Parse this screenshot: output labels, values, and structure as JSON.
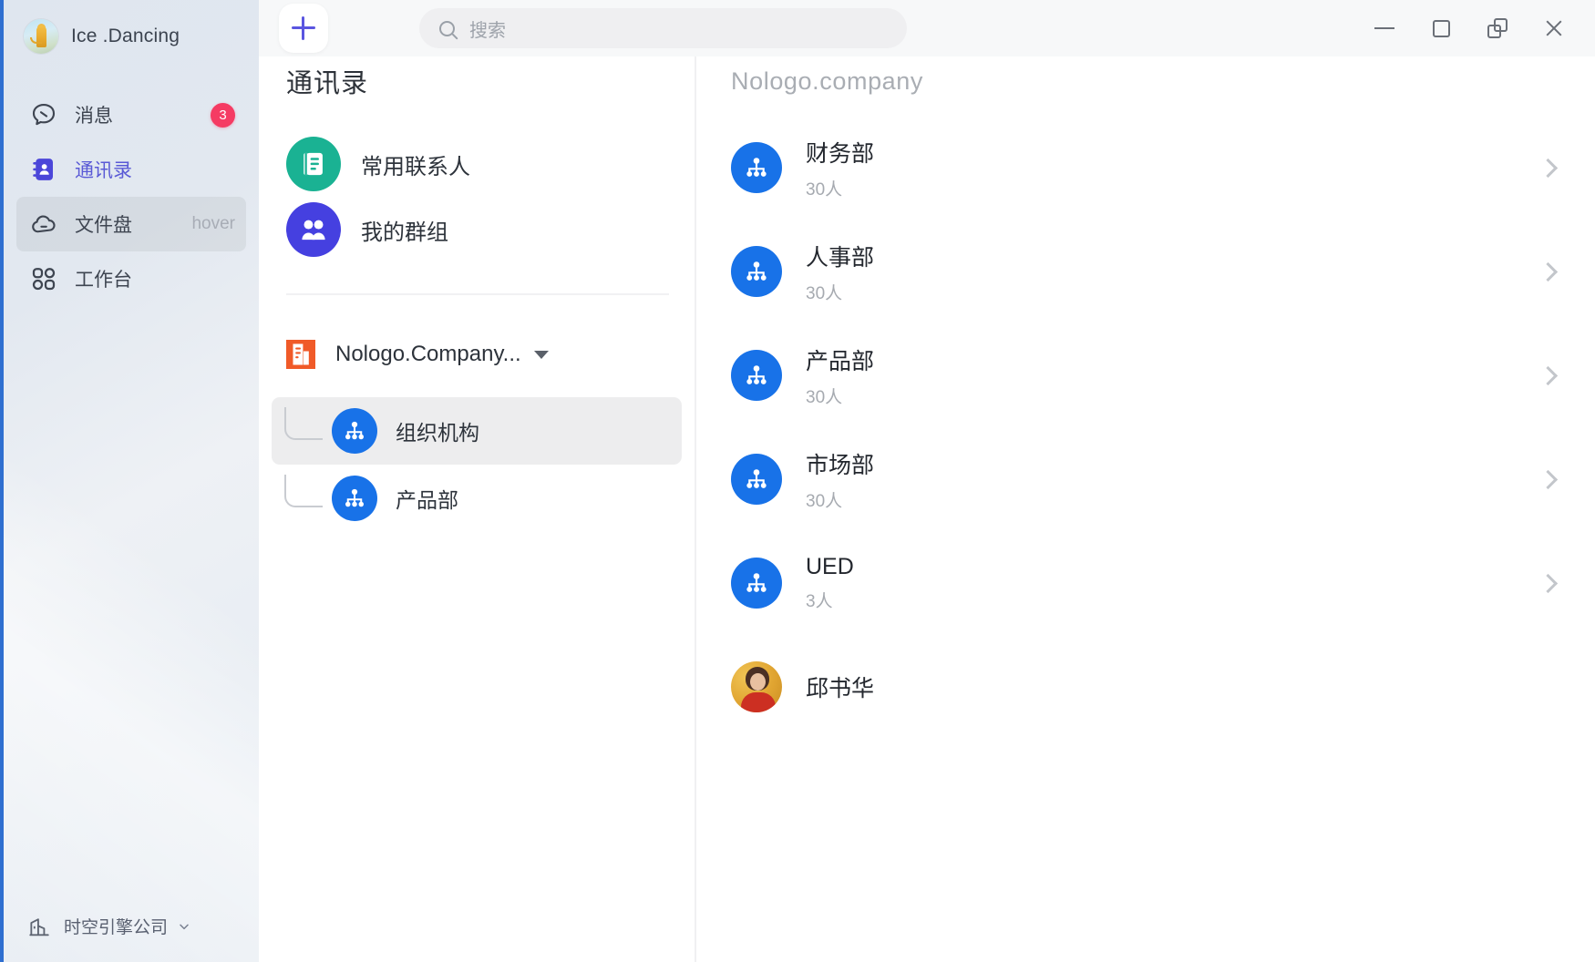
{
  "window": {
    "controls": [
      {
        "name": "minimize",
        "icon": "minimize-icon"
      },
      {
        "name": "maximize",
        "icon": "maximize-icon"
      },
      {
        "name": "restore",
        "icon": "restore-icon"
      },
      {
        "name": "close",
        "icon": "close-icon"
      }
    ]
  },
  "topbar": {
    "add_button_icon": "plus-icon",
    "search": {
      "icon": "search-icon",
      "placeholder": "搜索",
      "value": ""
    }
  },
  "sidebar": {
    "profile": {
      "name": "Ice .Dancing",
      "avatar": "user-avatar"
    },
    "items": [
      {
        "label": "消息",
        "icon": "message-icon",
        "badge": "3",
        "state": "default"
      },
      {
        "label": "通讯录",
        "icon": "contacts-icon",
        "state": "active"
      },
      {
        "label": "文件盘",
        "icon": "cloud-drive-icon",
        "hint": "hover",
        "state": "hover"
      },
      {
        "label": "工作台",
        "icon": "workbench-icon",
        "state": "default"
      }
    ],
    "footer": {
      "label": "时空引擎公司",
      "icon": "building-icon",
      "chevron": "chevron-down-icon"
    }
  },
  "middle": {
    "title": "通讯录",
    "shortcuts": [
      {
        "label": "常用联系人",
        "icon": "address-book-icon",
        "color": "#1ab293"
      },
      {
        "label": "我的群组",
        "icon": "group-icon",
        "color": "#4540e0"
      }
    ],
    "company": {
      "label": "Nologo.Company...",
      "icon": "company-icon",
      "color": "#f05a28",
      "caret": "caret-down-icon"
    },
    "tree": [
      {
        "label": "组织机构",
        "icon": "org-chart-icon",
        "color": "#1872e8",
        "selected": true
      },
      {
        "label": "产品部",
        "icon": "org-chart-icon",
        "color": "#1872e8",
        "selected": false
      }
    ]
  },
  "right": {
    "title": "Nologo.company",
    "rows": [
      {
        "type": "department",
        "name": "财务部",
        "count": "30人",
        "icon": "org-chart-icon",
        "color": "#1872e8",
        "chevron": "chevron-right-icon"
      },
      {
        "type": "department",
        "name": "人事部",
        "count": "30人",
        "icon": "org-chart-icon",
        "color": "#1872e8",
        "chevron": "chevron-right-icon"
      },
      {
        "type": "department",
        "name": "产品部",
        "count": "30人",
        "icon": "org-chart-icon",
        "color": "#1872e8",
        "chevron": "chevron-right-icon"
      },
      {
        "type": "department",
        "name": "市场部",
        "count": "30人",
        "icon": "org-chart-icon",
        "color": "#1872e8",
        "chevron": "chevron-right-icon"
      },
      {
        "type": "department",
        "name": "UED",
        "count": "3人",
        "icon": "org-chart-icon",
        "color": "#1872e8",
        "chevron": "chevron-right-icon"
      },
      {
        "type": "person",
        "name": "邱书华",
        "icon": "person-photo-avatar"
      }
    ]
  },
  "colors": {
    "accent_indigo": "#5a55e0",
    "badge_red": "#f53b63",
    "dept_blue": "#1872e8",
    "contacts_teal": "#1ab293",
    "group_violet": "#4540e0",
    "company_orange": "#f05a28",
    "sidebar_bg": "#e4eaf1",
    "sidebar_accent_edge": "#2f6fd0"
  }
}
